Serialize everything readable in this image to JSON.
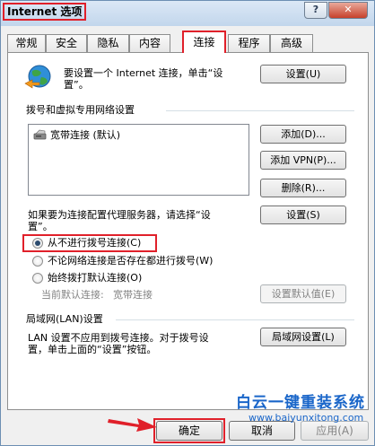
{
  "window": {
    "title": "Internet 选项",
    "help": "?",
    "close": "✕"
  },
  "tabs": [
    {
      "label": "常规"
    },
    {
      "label": "安全"
    },
    {
      "label": "隐私"
    },
    {
      "label": "内容"
    },
    {
      "label": "连接",
      "active": true
    },
    {
      "label": "程序"
    },
    {
      "label": "高级"
    }
  ],
  "setup": {
    "line1": "要设置一个 Internet 连接，单击“设",
    "line2": "置”。",
    "button": "设置(U)"
  },
  "dialup": {
    "group_label": "拨号和虚拟专用网络设置",
    "connections": [
      {
        "name": "宽带连接 (默认)"
      }
    ],
    "add_button": "添加(D)...",
    "add_vpn_button": "添加 VPN(P)...",
    "remove_button": "删除(R)...",
    "proxy_text_line1": "如果要为连接配置代理服务器，请选择“设",
    "proxy_text_line2": "置”。",
    "settings_button": "设置(S)",
    "options": [
      {
        "label": "从不进行拨号连接(C)",
        "selected": true
      },
      {
        "label": "不论网络连接是否存在都进行拨号(W)",
        "selected": false
      },
      {
        "label": "始终拨打默认连接(O)",
        "selected": false
      }
    ],
    "current_default_label": "当前默认连接:",
    "current_default_value": "宽带连接",
    "set_default_button": "设置默认值(E)"
  },
  "lan": {
    "group_label": "局域网(LAN)设置",
    "line1": "LAN 设置不应用到拨号连接。对于拨号设",
    "line2": "置，单击上面的“设置”按钮。",
    "button": "局域网设置(L)"
  },
  "footer": {
    "ok": "确定",
    "cancel": "取消",
    "apply": "应用(A)"
  },
  "watermark": {
    "title": "白云一键重装系统",
    "url": "www.baiyunxitong.com"
  },
  "colors": {
    "highlight": "#e0202a",
    "accent_arrow": "#e0202a"
  }
}
